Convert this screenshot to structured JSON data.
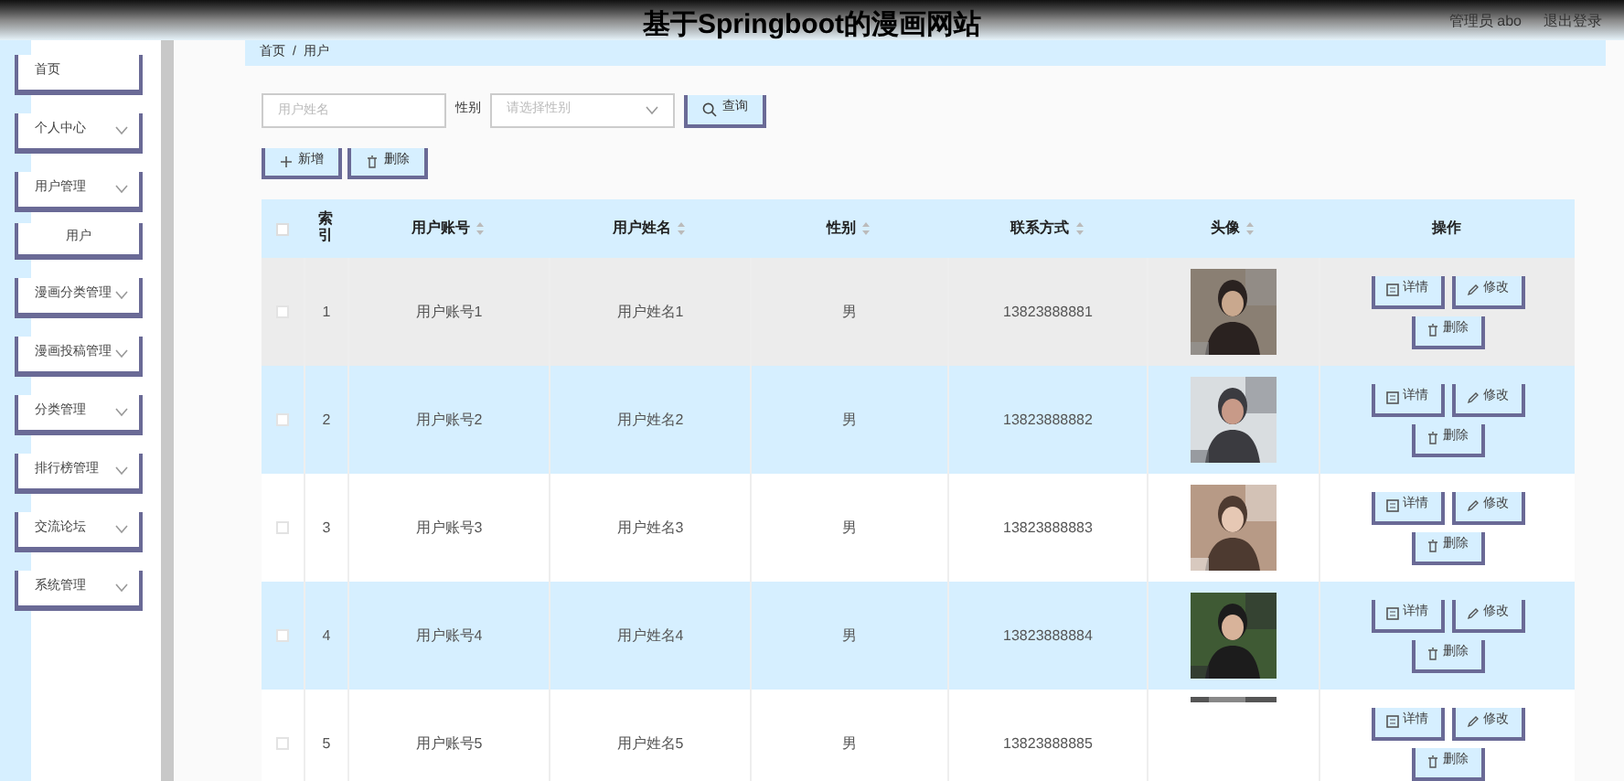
{
  "header": {
    "title": "基于Springboot的漫画网站",
    "user": "管理员 abo",
    "logout": "退出登录"
  },
  "sidebar": {
    "items": [
      {
        "label": "首页",
        "kind": "link"
      },
      {
        "label": "个人中心",
        "kind": "group"
      },
      {
        "label": "用户管理",
        "kind": "group"
      },
      {
        "label": "用户",
        "kind": "subitem"
      },
      {
        "label": "漫画分类管理",
        "kind": "group"
      },
      {
        "label": "漫画投稿管理",
        "kind": "group"
      },
      {
        "label": "分类管理",
        "kind": "group"
      },
      {
        "label": "排行榜管理",
        "kind": "group"
      },
      {
        "label": "交流论坛",
        "kind": "group"
      },
      {
        "label": "系统管理",
        "kind": "group"
      }
    ]
  },
  "breadcrumb": {
    "items": [
      "首页",
      "用户"
    ],
    "separator": "/"
  },
  "filters": {
    "name": {
      "placeholder": "用户姓名"
    },
    "gender_label": "性别",
    "gender": {
      "placeholder": "请选择性别"
    },
    "search": "查询"
  },
  "actions": [
    "新增",
    "删除"
  ],
  "table": {
    "select_all": {
      "checked": false
    },
    "columns": [
      {
        "label": "索引",
        "sortable": false
      },
      {
        "label": "用户账号",
        "sortable": true
      },
      {
        "label": "用户姓名",
        "sortable": true
      },
      {
        "label": "性别",
        "sortable": true
      },
      {
        "label": "联系方式",
        "sortable": true
      },
      {
        "label": "头像",
        "sortable": true
      },
      {
        "label": "操作",
        "sortable": false
      }
    ],
    "rows": [
      {
        "index": "1",
        "account": "用户账号1",
        "name": "用户姓名1",
        "gender": "男",
        "phone": "13823888881",
        "hovered": true,
        "checked": false,
        "buttons": [
          "详情",
          "修改",
          "删除"
        ]
      },
      {
        "index": "2",
        "account": "用户账号2",
        "name": "用户姓名2",
        "gender": "男",
        "phone": "13823888882",
        "hovered": false,
        "checked": false,
        "buttons": [
          "详情",
          "修改",
          "删除"
        ]
      },
      {
        "index": "3",
        "account": "用户账号3",
        "name": "用户姓名3",
        "gender": "男",
        "phone": "13823888883",
        "hovered": false,
        "checked": false,
        "buttons": [
          "详情",
          "修改",
          "删除"
        ]
      },
      {
        "index": "4",
        "account": "用户账号4",
        "name": "用户姓名4",
        "gender": "男",
        "phone": "13823888884",
        "hovered": false,
        "checked": false,
        "buttons": [
          "详情",
          "修改",
          "删除"
        ]
      },
      {
        "index": "5",
        "account": "用户账号5",
        "name": "用户姓名5",
        "gender": "男",
        "phone": "13823888885",
        "hovered": false,
        "checked": false,
        "buttons": [
          "详情",
          "修改",
          "删除"
        ]
      }
    ]
  }
}
